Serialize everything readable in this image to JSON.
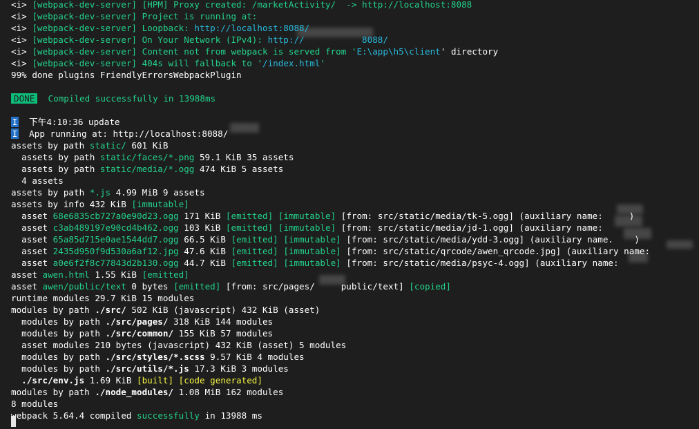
{
  "terminal": {
    "lines": [
      {
        "spans": [
          {
            "t": "<i> ",
            "c": "w"
          },
          {
            "t": "[webpack-dev-server]",
            "c": "g"
          },
          {
            "t": " [HPM] Proxy created: /marketActivity/  -> http://localhost:8088",
            "c": "g"
          }
        ]
      },
      {
        "spans": [
          {
            "t": "<i> ",
            "c": "w"
          },
          {
            "t": "[webpack-dev-server]",
            "c": "g"
          },
          {
            "t": " Project is running at:",
            "c": "g"
          }
        ]
      },
      {
        "spans": [
          {
            "t": "<i> ",
            "c": "w"
          },
          {
            "t": "[webpack-dev-server]",
            "c": "g"
          },
          {
            "t": " Loopback: ",
            "c": "g"
          },
          {
            "t": "http://localhost:8088/",
            "c": "c"
          }
        ]
      },
      {
        "spans": [
          {
            "t": "<i> ",
            "c": "w"
          },
          {
            "t": "[webpack-dev-server]",
            "c": "g"
          },
          {
            "t": " On Your Network (IPv4): ",
            "c": "g"
          },
          {
            "t": "http://",
            "c": "c"
          },
          {
            "t": "           ",
            "c": "c"
          },
          {
            "t": "8088/",
            "c": "c"
          }
        ]
      },
      {
        "spans": [
          {
            "t": "<i> ",
            "c": "w"
          },
          {
            "t": "[webpack-dev-server]",
            "c": "g"
          },
          {
            "t": " Content not from webpack is served from '",
            "c": "g"
          },
          {
            "t": "E:\\app\\h5\\client",
            "c": "c"
          },
          {
            "t": "' directory",
            "c": "w"
          }
        ]
      },
      {
        "spans": [
          {
            "t": "<i> ",
            "c": "w"
          },
          {
            "t": "[webpack-dev-server]",
            "c": "g"
          },
          {
            "t": " 404s will fallback to '",
            "c": "g"
          },
          {
            "t": "/index.html",
            "c": "c"
          },
          {
            "t": "'",
            "c": "g"
          }
        ]
      },
      {
        "spans": [
          {
            "t": "99% done plugins FriendlyErrorsWebpackPlugin",
            "c": "w"
          }
        ]
      },
      {
        "spans": []
      },
      {
        "spans": [
          {
            "t": "DONE",
            "badge": "done"
          },
          {
            "t": "  Compiled successfully in 13988ms",
            "c": "g"
          }
        ]
      },
      {
        "spans": []
      },
      {
        "spans": [
          {
            "t": "I",
            "badge": "info"
          },
          {
            "t": "  下午4:10:36 update",
            "c": "w"
          }
        ]
      },
      {
        "spans": [
          {
            "t": "I",
            "badge": "info"
          },
          {
            "t": "  App running at: http://localhost:8088/",
            "c": "w"
          }
        ]
      },
      {
        "spans": [
          {
            "t": "assets by path ",
            "c": "w"
          },
          {
            "t": "static/",
            "c": "g"
          },
          {
            "t": " 601 KiB",
            "c": "w"
          }
        ]
      },
      {
        "spans": [
          {
            "t": "  assets by path ",
            "c": "w"
          },
          {
            "t": "static/faces/*.png",
            "c": "g"
          },
          {
            "t": " 59.1 KiB 35 assets",
            "c": "w"
          }
        ]
      },
      {
        "spans": [
          {
            "t": "  assets by path ",
            "c": "w"
          },
          {
            "t": "static/media/*.ogg",
            "c": "g"
          },
          {
            "t": " 474 KiB 5 assets",
            "c": "w"
          }
        ]
      },
      {
        "spans": [
          {
            "t": "  4 assets",
            "c": "w"
          }
        ]
      },
      {
        "spans": [
          {
            "t": "assets by path ",
            "c": "w"
          },
          {
            "t": "*.js",
            "c": "g"
          },
          {
            "t": " 4.99 MiB 9 assets",
            "c": "w"
          }
        ]
      },
      {
        "spans": [
          {
            "t": "assets by info 432 KiB ",
            "c": "w"
          },
          {
            "t": "[immutable]",
            "c": "g"
          }
        ]
      },
      {
        "spans": [
          {
            "t": "  asset ",
            "c": "w"
          },
          {
            "t": "68e6835cb727a0e90d23.ogg",
            "c": "g"
          },
          {
            "t": " 171 KiB ",
            "c": "w"
          },
          {
            "t": "[emitted]",
            "c": "g"
          },
          {
            "t": " ",
            "c": "w"
          },
          {
            "t": "[immutable]",
            "c": "g"
          },
          {
            "t": " [from: src/static/media/tk-5.ogg] (auxiliary name:     )",
            "c": "w"
          }
        ]
      },
      {
        "spans": [
          {
            "t": "  asset ",
            "c": "w"
          },
          {
            "t": "c3ab489197e90cd4b462.ogg",
            "c": "g"
          },
          {
            "t": " 103 KiB ",
            "c": "w"
          },
          {
            "t": "[emitted]",
            "c": "g"
          },
          {
            "t": " ",
            "c": "w"
          },
          {
            "t": "[immutable]",
            "c": "g"
          },
          {
            "t": " [from: src/static/media/jd-1.ogg] (auxiliary name:",
            "c": "w"
          }
        ]
      },
      {
        "spans": [
          {
            "t": "  asset ",
            "c": "w"
          },
          {
            "t": "65a85d715e0ae1544dd7.ogg",
            "c": "g"
          },
          {
            "t": " 66.5 KiB ",
            "c": "w"
          },
          {
            "t": "[emitted]",
            "c": "g"
          },
          {
            "t": " ",
            "c": "w"
          },
          {
            "t": "[immutable]",
            "c": "g"
          },
          {
            "t": " [from: src/static/media/ydd-3.ogg] (auxiliary name.    )",
            "c": "w"
          }
        ]
      },
      {
        "spans": [
          {
            "t": "  asset ",
            "c": "w"
          },
          {
            "t": "2435d950f9d530a6af12.jpg",
            "c": "g"
          },
          {
            "t": " 47.6 KiB ",
            "c": "w"
          },
          {
            "t": "[emitted]",
            "c": "g"
          },
          {
            "t": " ",
            "c": "w"
          },
          {
            "t": "[immutable]",
            "c": "g"
          },
          {
            "t": " [from: src/static/qrcode/awen_qrcode.jpg] (auxiliary name:",
            "c": "w"
          }
        ]
      },
      {
        "spans": [
          {
            "t": "  asset ",
            "c": "w"
          },
          {
            "t": "a0e6f2f8c77843d2b130.ogg",
            "c": "g"
          },
          {
            "t": " 44.7 KiB ",
            "c": "w"
          },
          {
            "t": "[emitted]",
            "c": "g"
          },
          {
            "t": " ",
            "c": "w"
          },
          {
            "t": "[immutable]",
            "c": "g"
          },
          {
            "t": " [from: src/static/media/psyc-4.ogg] (auxiliary name:",
            "c": "w"
          }
        ]
      },
      {
        "spans": [
          {
            "t": "asset ",
            "c": "w"
          },
          {
            "t": "awen.html",
            "c": "g"
          },
          {
            "t": " 1.55 KiB ",
            "c": "w"
          },
          {
            "t": "[emitted]",
            "c": "g"
          }
        ]
      },
      {
        "spans": [
          {
            "t": "asset ",
            "c": "w"
          },
          {
            "t": "awen/public/text",
            "c": "g"
          },
          {
            "t": " 0 bytes ",
            "c": "w"
          },
          {
            "t": "[emitted]",
            "c": "g"
          },
          {
            "t": " [from: src/pages/     public/text] ",
            "c": "w"
          },
          {
            "t": "[copied]",
            "c": "g"
          }
        ]
      },
      {
        "spans": [
          {
            "t": "runtime modules 29.7 KiB 15 modules",
            "c": "w"
          }
        ]
      },
      {
        "spans": [
          {
            "t": "modules by path ",
            "c": "w"
          },
          {
            "t": "./src/",
            "c": "w",
            "b": true
          },
          {
            "t": " 502 KiB (javascript) 432 KiB (asset)",
            "c": "w"
          }
        ]
      },
      {
        "spans": [
          {
            "t": "  modules by path ",
            "c": "w"
          },
          {
            "t": "./src/pages/",
            "c": "w",
            "b": true
          },
          {
            "t": " 318 KiB 144 modules",
            "c": "w"
          }
        ]
      },
      {
        "spans": [
          {
            "t": "  modules by path ",
            "c": "w"
          },
          {
            "t": "./src/common/",
            "c": "w",
            "b": true
          },
          {
            "t": " 155 KiB 57 modules",
            "c": "w"
          }
        ]
      },
      {
        "spans": [
          {
            "t": "  asset modules 210 bytes (javascript) 432 KiB (asset) 5 modules",
            "c": "w"
          }
        ]
      },
      {
        "spans": [
          {
            "t": "  modules by path ",
            "c": "w"
          },
          {
            "t": "./src/styles/*.scss",
            "c": "w",
            "b": true
          },
          {
            "t": " 9.57 KiB 4 modules",
            "c": "w"
          }
        ]
      },
      {
        "spans": [
          {
            "t": "  modules by path ",
            "c": "w"
          },
          {
            "t": "./src/utils/*.js",
            "c": "w",
            "b": true
          },
          {
            "t": " 17.3 KiB 3 modules",
            "c": "w"
          }
        ]
      },
      {
        "spans": [
          {
            "t": "  ./src/env.js",
            "c": "w",
            "b": true
          },
          {
            "t": " 1.69 KiB ",
            "c": "w"
          },
          {
            "t": "[built]",
            "c": "y"
          },
          {
            "t": " ",
            "c": "w"
          },
          {
            "t": "[code generated]",
            "c": "y"
          }
        ]
      },
      {
        "spans": [
          {
            "t": "modules by path ",
            "c": "w"
          },
          {
            "t": "./node_modules/",
            "c": "w",
            "b": true
          },
          {
            "t": " 1.08 MiB 162 modules",
            "c": "w"
          }
        ]
      },
      {
        "spans": [
          {
            "t": "8 modules",
            "c": "w"
          }
        ]
      },
      {
        "spans": [
          {
            "t": "webpack 5.64.4 compiled ",
            "c": "w"
          },
          {
            "t": "successfully",
            "c": "g"
          },
          {
            "t": " in 13988 ms",
            "c": "w"
          }
        ]
      }
    ]
  }
}
